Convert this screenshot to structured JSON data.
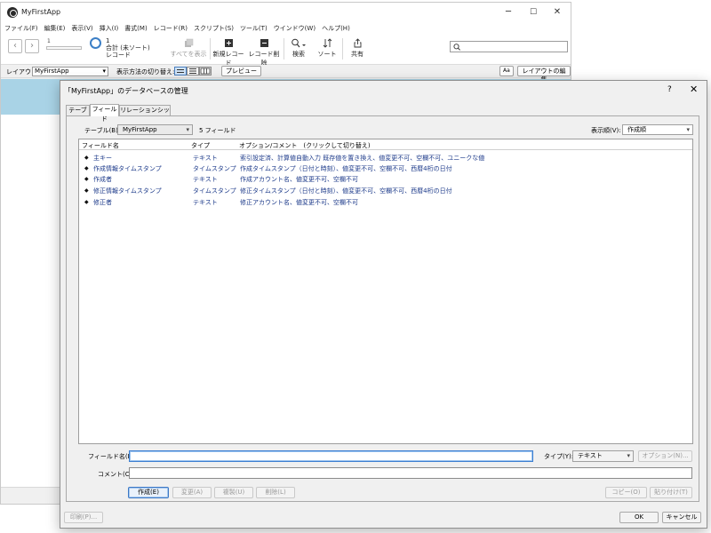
{
  "main": {
    "title": "MyFirstApp",
    "window_controls": {
      "minimize": "─",
      "maximize": "☐",
      "close": "✕"
    },
    "menu": [
      "ファイル(F)",
      "編集(E)",
      "表示(V)",
      "挿入(I)",
      "書式(M)",
      "レコード(R)",
      "スクリプト(S)",
      "ツール(T)",
      "ウインドウ(W)",
      "ヘルプ(H)"
    ],
    "toolbar": {
      "record_number": "1",
      "record_count": "1",
      "record_status": "合計 (未ソート)",
      "record_label": "レコード",
      "show_all": "すべてを表示",
      "new_record": "新規レコード",
      "delete_record": "レコード削除",
      "find": "検索",
      "sort": "ソート",
      "share": "共有",
      "search_placeholder": ""
    },
    "layoutbar": {
      "layout_label": "レイアウト:",
      "layout_value": "MyFirstApp",
      "view_label": "表示方法の切り替え:",
      "preview": "プレビュー",
      "aa": "Aa",
      "edit_layout": "レイアウトの編集"
    }
  },
  "dialog": {
    "title": "「MyFirstApp」のデータベースの管理",
    "help": "?",
    "close": "✕",
    "tabs": [
      "テーブル",
      "フィールド",
      "リレーションシップ"
    ],
    "active_tab": 1,
    "table_label": "テーブル(B):",
    "table_value": "MyFirstApp",
    "field_count": "5 フィールド",
    "sort_label": "表示順(V):",
    "sort_value": "作成順",
    "columns": {
      "name": "フィールド名",
      "type": "タイプ",
      "options": "オプション/コメント　(クリックして切り替え)"
    },
    "fields": [
      {
        "name": "主キー",
        "type": "テキスト",
        "options": "索引設定済、計算値自動入力 既存値を置き換え、値変更不可、空欄不可、ユニークな値"
      },
      {
        "name": "作成情報タイムスタンプ",
        "type": "タイムスタンプ",
        "options": "作成タイムスタンプ（日付と時刻）、値変更不可、空欄不可、西暦4桁の日付"
      },
      {
        "name": "作成者",
        "type": "テキスト",
        "options": "作成アカウント名、値変更不可、空欄不可"
      },
      {
        "name": "修正情報タイムスタンプ",
        "type": "タイムスタンプ",
        "options": "修正タイムスタンプ（日付と時刻）、値変更不可、空欄不可、西暦4桁の日付"
      },
      {
        "name": "修正者",
        "type": "テキスト",
        "options": "修正アカウント名、値変更不可、空欄不可"
      }
    ],
    "field_name_label": "フィールド名(F):",
    "field_name_value": "",
    "type_label": "タイプ(Y):",
    "type_value": "テキスト",
    "options_button": "オプション(N)...",
    "comment_label": "コメント(C):",
    "comment_value": "",
    "buttons": {
      "create": "作成(E)",
      "change": "変更(A)",
      "duplicate": "複製(U)",
      "delete": "削除(L)",
      "copy": "コピー(O)",
      "paste": "貼り付け(T)",
      "print": "印刷(P)...",
      "ok": "OK",
      "cancel": "キャンセル"
    }
  }
}
